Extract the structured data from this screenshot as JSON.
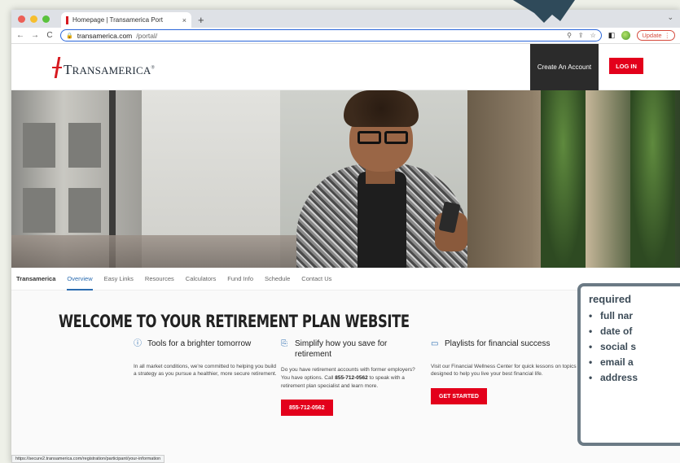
{
  "browser": {
    "tab_title": "Homepage | Transamerica Port",
    "tab_close": "×",
    "new_tab": "+",
    "url_host": "transamerica.com",
    "url_path": "/portal/",
    "update_label": "Update",
    "update_menu": "⋮",
    "tab_menu": "⌄",
    "nav_back": "←",
    "nav_forward": "→",
    "nav_reload": "C",
    "url_lock": "🔒",
    "url_icon_zoom": "⚲",
    "url_icon_share": "⇪",
    "url_icon_star": "☆",
    "ext_icon": "◧",
    "traffic_colors": [
      "#ec5f57",
      "#f6be2f",
      "#5ac23c"
    ]
  },
  "header": {
    "logo_text_a": "T",
    "logo_text_b": "RANSAMERICA",
    "logo_reg": "®",
    "create_account": "Create An Account",
    "login": "LOG IN"
  },
  "subnav": {
    "brand": "Transamerica",
    "items": [
      "Overview",
      "Easy Links",
      "Resources",
      "Calculators",
      "Fund Info",
      "Schedule",
      "Contact Us"
    ]
  },
  "content": {
    "welcome": "WELCOME TO YOUR RETIREMENT PLAN WEBSITE",
    "columns": [
      {
        "icon": "ⓘ",
        "heading": "Tools for a brighter tomorrow",
        "body": "In all market conditions, we're committed to helping you build a strategy as you pursue a healthier, more secure retirement."
      },
      {
        "icon": "⎘",
        "heading": "Simplify how you save for retirement",
        "body_pre": "Do you have retirement accounts with former employers? You have options. Call ",
        "body_bold": "855-712-0562",
        "body_post": " to speak with a retirement plan specialist and learn more.",
        "cta": "855-712-0562"
      },
      {
        "icon": "▭",
        "heading": "Playlists for financial success",
        "body": "Visit our Financial Wellness Center for quick lessons on topics designed to help you live your best financial life.",
        "cta": "GET STARTED"
      }
    ],
    "status_url": "https://secure2.transamerica.com/registration/participant/your-information"
  },
  "callout": {
    "title": "required",
    "bullet": "•",
    "items": [
      "full nar",
      "date of",
      "social s",
      "email a",
      "address"
    ]
  },
  "colors": {
    "brand_red": "#e3001b",
    "link_blue": "#2b6cb0",
    "callout_border": "#6b7a85",
    "arrow": "#2f4a5a"
  }
}
